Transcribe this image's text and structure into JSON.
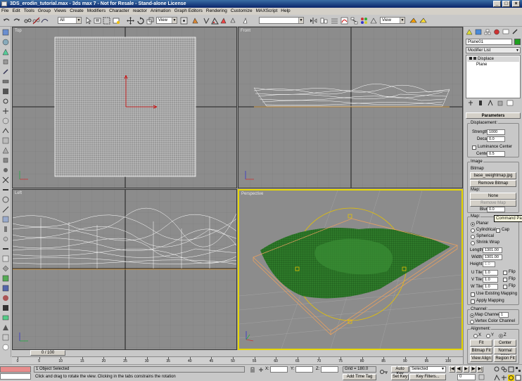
{
  "window": {
    "title": "3DS_erodin_tutorial.max - 3ds max 7  - Not for Resale - Stand-alone License",
    "minimize": "_",
    "maximize": "□",
    "close": "×"
  },
  "menu": [
    "File",
    "Edit",
    "Tools",
    "Group",
    "Views",
    "Create",
    "Modifiers",
    "Character",
    "reactor",
    "Animation",
    "Graph Editors",
    "Rendering",
    "Customize",
    "MAXScript",
    "Help"
  ],
  "toolbar": {
    "selection_filter": "All",
    "ref_coord": "View",
    "named_sel": "",
    "view_dropdown": "View"
  },
  "viewports": {
    "top": "Top",
    "front": "Front",
    "left": "Left",
    "perspective": "Perspective"
  },
  "command_panel": {
    "object_name": "Plane01",
    "object_color": "#1ea01e",
    "modifier_list": "Modifier List",
    "stack": [
      "Displace",
      "Plane"
    ],
    "rollout_title": "Parameters",
    "displacement": {
      "title": "Displacement:",
      "strength_label": "Strength:",
      "strength": "1000",
      "decay_label": "Decay:",
      "decay": "0.0",
      "luminance_center": "Luminance Center",
      "center_label": "Center:",
      "center": "0.5"
    },
    "image": {
      "title": "Image",
      "bitmap_label": "Bitmap",
      "bitmap_file": "base_weightmap.jpg",
      "remove_bitmap": "Remove Bitmap",
      "map_label": "Map:",
      "map_none": "None",
      "remove_map": "Remove Map",
      "blur_label": "Blur:",
      "blur": "0.0"
    },
    "tooltip": "Command Panel",
    "map": {
      "title": "Map:",
      "planar": "Planar",
      "cylindrical": "Cylindrical",
      "cap": "Cap",
      "spherical": "Spherical",
      "shrink_wrap": "Shrink Wrap",
      "length_label": "Length:",
      "length": "1301.00",
      "width_label": "Width:",
      "width": "1301.00",
      "height_label": "Height:",
      "height": "1.0",
      "utile_label": "U Tile:",
      "utile": "1.0",
      "vtile_label": "V Tile:",
      "vtile": "1.0",
      "wtile_label": "W Tile:",
      "wtile": "1.0",
      "flip": "Flip",
      "use_existing": "Use Existing Mapping",
      "apply_mapping": "Apply Mapping"
    },
    "channel": {
      "title": "Channel:",
      "map_channel": "Map Channel:",
      "map_channel_value": "1",
      "vertex_color": "Vertex Color Channel"
    },
    "alignment": {
      "title": "Alignment:",
      "x": "X",
      "y": "Y",
      "z": "Z",
      "fit": "Fit",
      "center": "Center",
      "bitmap_fit": "Bitmap Fit",
      "normal_align": "Normal Align",
      "view_align": "View Align",
      "region_fit": "Region Fit"
    }
  },
  "timeline": {
    "frame_slider": "0 / 100",
    "ticks": [
      "0",
      "5",
      "10",
      "15",
      "20",
      "25",
      "30",
      "35",
      "40",
      "45",
      "50",
      "55",
      "60",
      "65",
      "70",
      "75",
      "80",
      "85",
      "90",
      "95",
      "100"
    ]
  },
  "status": {
    "selection": "1 Object Selected",
    "prompt": "Click and drag to rotate the view.  Clicking in the tabs constrains the rotation",
    "x_label": "X:",
    "y_label": "Y:",
    "z_label": "Z:",
    "grid": "Grid = 180.0",
    "add_time_tag": "Add Time Tag",
    "auto_key": "Auto Key",
    "set_key": "Set Key",
    "selected": "Selected",
    "key_filters": "Key Filters...",
    "frame": "0"
  }
}
